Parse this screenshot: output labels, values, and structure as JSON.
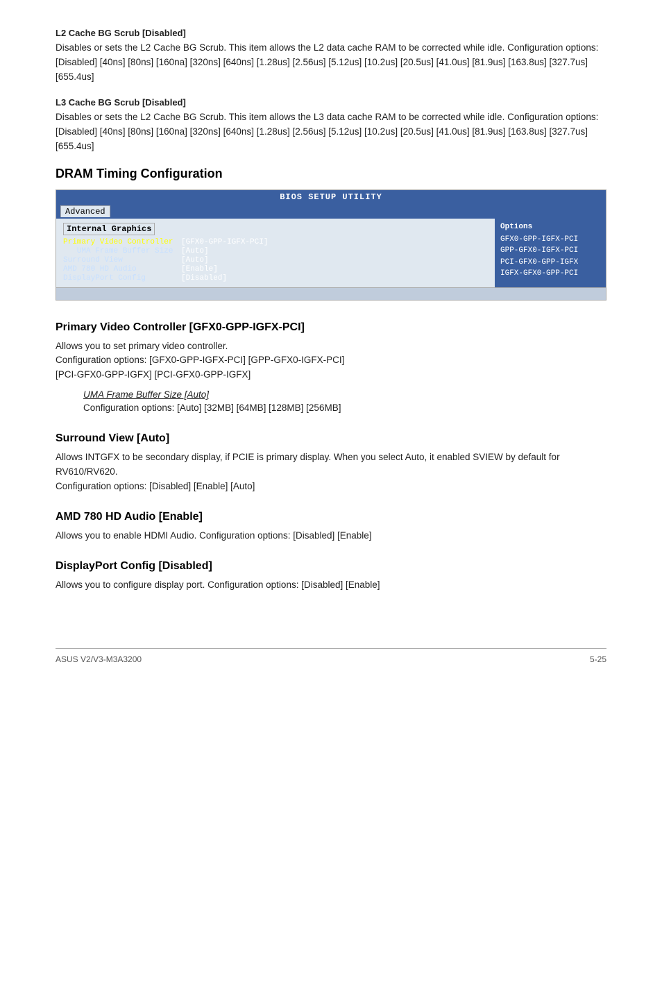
{
  "page": {
    "footer_left": "ASUS V2/V3-M3A3200",
    "footer_right": "5-25"
  },
  "l2_cache": {
    "label": "L2 Cache BG Scrub [Disabled]",
    "body": "Disables or sets the L2 Cache BG Scrub. This item allows the L2 data cache RAM to be corrected while idle. Configuration options: [Disabled] [40ns] [80ns] [160na] [320ns] [640ns] [1.28us] [2.56us] [5.12us] [10.2us] [20.5us] [41.0us] [81.9us] [163.8us] [327.7us] [655.4us]"
  },
  "l3_cache": {
    "label": "L3 Cache BG Scrub [Disabled]",
    "body": "Disables or sets the L2 Cache BG Scrub. This item allows the L3 data cache RAM to be corrected while idle. Configuration options: [Disabled] [40ns] [80ns] [160na] [320ns] [640ns] [1.28us] [2.56us] [5.12us] [10.2us] [20.5us] [41.0us] [81.9us] [163.8us] [327.7us] [655.4us]"
  },
  "dram_section": {
    "heading": "DRAM Timing Configuration"
  },
  "bios": {
    "title": "BIOS SETUP UTILITY",
    "nav_item": "Advanced",
    "section_title": "Internal Graphics",
    "options_title": "Options",
    "rows": [
      {
        "label": "Primary Video Controller",
        "value": "[GFX0-GPP-IGFX-PCI]"
      },
      {
        "label": "   UMA Frame Buffer Size",
        "value": "[Auto]"
      },
      {
        "label": "Surround View",
        "value": "[Auto]"
      },
      {
        "label": "AMD 780 HD Audio",
        "value": "[Enable]"
      },
      {
        "label": "DisplayPort Config",
        "value": "[Disabled]"
      }
    ],
    "options": [
      "GFX0-GPP-IGFX-PCI",
      "GPP-GFX0-IGFX-PCI",
      "PCI-GFX0-GPP-IGFX",
      "IGFX-GFX0-GPP-PCI"
    ]
  },
  "primary_video": {
    "heading": "Primary Video Controller [GFX0-GPP-IGFX-PCI]",
    "body": "Allows you to set primary video controller.\nConfiguration options: [GFX0-GPP-IGFX-PCI] [GPP-GFX0-IGFX-PCI] [PCI-GFX0-GPP-IGFX] [PCI-GFX0-GPP-IGFX]"
  },
  "uma_frame": {
    "label": "UMA Frame Buffer Size [Auto]",
    "body": "Configuration options: [Auto] [32MB] [64MB] [128MB] [256MB]"
  },
  "surround_view": {
    "heading": "Surround View [Auto]",
    "body": "Allows INTGFX to be secondary display, if PCIE is primary display. When you select Auto, it enabled SVIEW by default for RV610/RV620.\nConfiguration options: [Disabled] [Enable] [Auto]"
  },
  "amd_audio": {
    "heading": "AMD 780 HD Audio [Enable]",
    "body": "Allows you to enable HDMI Audio. Configuration options: [Disabled] [Enable]"
  },
  "displayport": {
    "heading": "DisplayPort Config [Disabled]",
    "body": "Allows you to configure display port. Configuration options: [Disabled] [Enable]"
  }
}
